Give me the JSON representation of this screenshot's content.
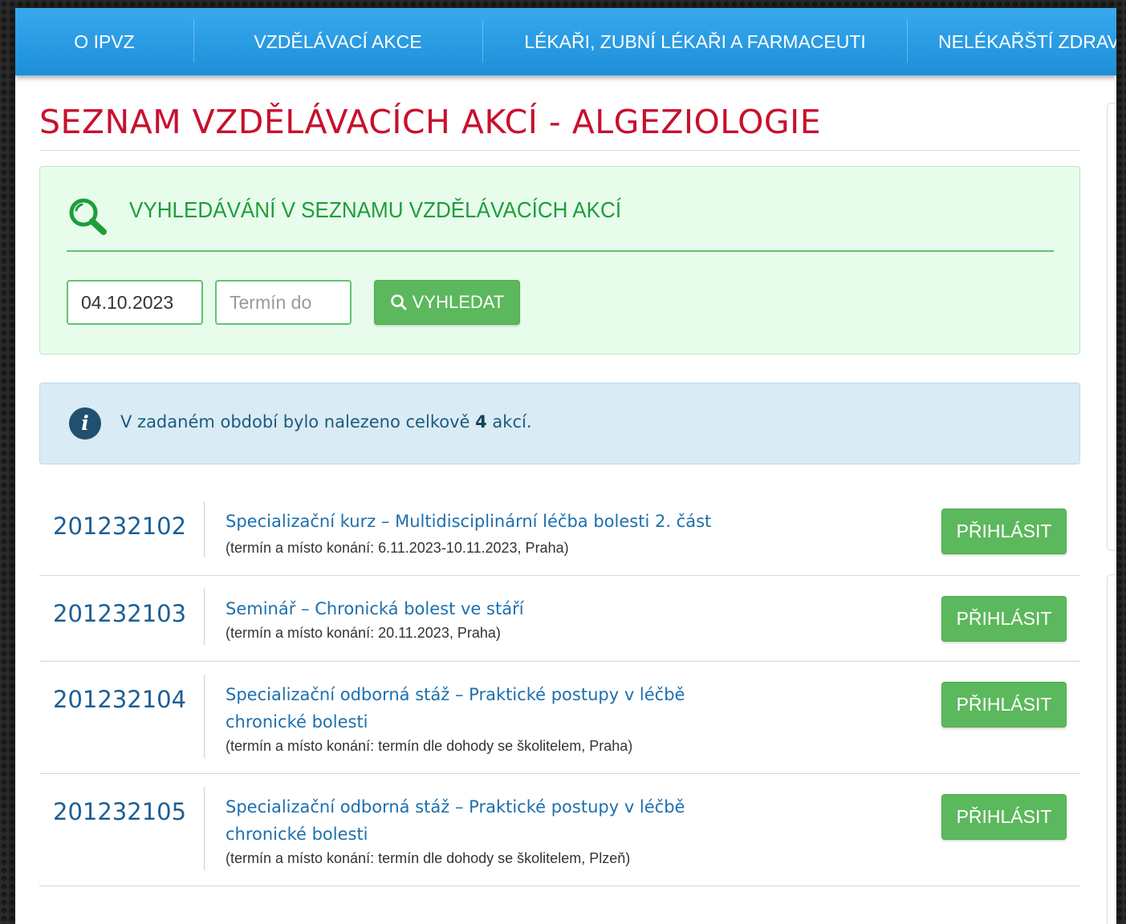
{
  "nav": {
    "items": [
      {
        "label": "O IPVZ"
      },
      {
        "label": "VZDĚLÁVACÍ AKCE"
      },
      {
        "label": "LÉKAŘI, ZUBNÍ LÉKAŘI A FARMACEUTI"
      },
      {
        "label": "NELÉKAŘŠTÍ ZDRAV"
      }
    ]
  },
  "page": {
    "title": "SEZNAM VZDĚLÁVACÍCH AKCÍ - ALGEZIOLOGIE"
  },
  "search": {
    "heading": "VYHLEDÁVÁNÍ V SEZNAMU VZDĚLÁVACÍCH AKCÍ",
    "date_from_value": "04.10.2023",
    "date_to_placeholder": "Termín do",
    "button_label": "VYHLEDAT",
    "icon": "search-icon",
    "accent_color": "#5ec56f"
  },
  "info": {
    "icon": "info-icon",
    "text_before": "V zadaném období bylo nalezeno celkově",
    "count": "4",
    "text_after": "akcí."
  },
  "events": [
    {
      "id": "201232102",
      "title": "Specializační kurz – Multidisciplinární léčba bolesti 2. část",
      "meta": "(termín a místo konání: 6.11.2023-10.11.2023, Praha)",
      "button_label": "PŘIHLÁSIT"
    },
    {
      "id": "201232103",
      "title": "Seminář – Chronická bolest ve stáří",
      "meta": "(termín a místo konání: 20.11.2023, Praha)",
      "button_label": "PŘIHLÁSIT"
    },
    {
      "id": "201232104",
      "title": "Specializační odborná stáž – Praktické postupy v léčbě chronické bolesti",
      "meta": "(termín a místo konání: termín dle dohody se školitelem, Praha)",
      "button_label": "PŘIHLÁSIT"
    },
    {
      "id": "201232105",
      "title": "Specializační odborná stáž – Praktické postupy v léčbě chronické bolesti",
      "meta": "(termín a místo konání: termín dle dohody se školitelem, Plzeň)",
      "button_label": "PŘIHLÁSIT"
    }
  ],
  "colors": {
    "nav": "#1d8fd9",
    "title": "#c8102e",
    "link": "#1d6fad",
    "button": "#5cb85c"
  }
}
